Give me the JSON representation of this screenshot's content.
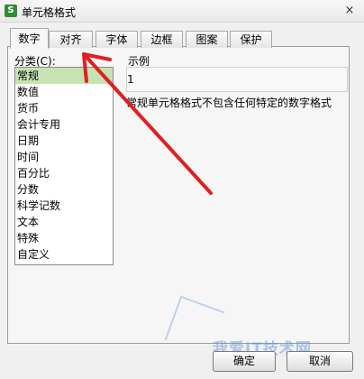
{
  "window": {
    "title": "单元格格式",
    "icon": "S",
    "close": "×"
  },
  "tabs": [
    "数字",
    "对齐",
    "字体",
    "边框",
    "图案",
    "保护"
  ],
  "category": {
    "label": "分类(C):",
    "items": [
      "常规",
      "数值",
      "货币",
      "会计专用",
      "日期",
      "时间",
      "百分比",
      "分数",
      "科学记数",
      "文本",
      "特殊",
      "自定义"
    ],
    "selected": "常规"
  },
  "sample": {
    "label": "示例",
    "value": "1"
  },
  "description": "常规单元格格式不包含任何特定的数字格式",
  "buttons": {
    "ok": "确定",
    "cancel": "取消"
  },
  "watermark": "我爱IT技术网",
  "annotation": {
    "color": "#e02020"
  }
}
